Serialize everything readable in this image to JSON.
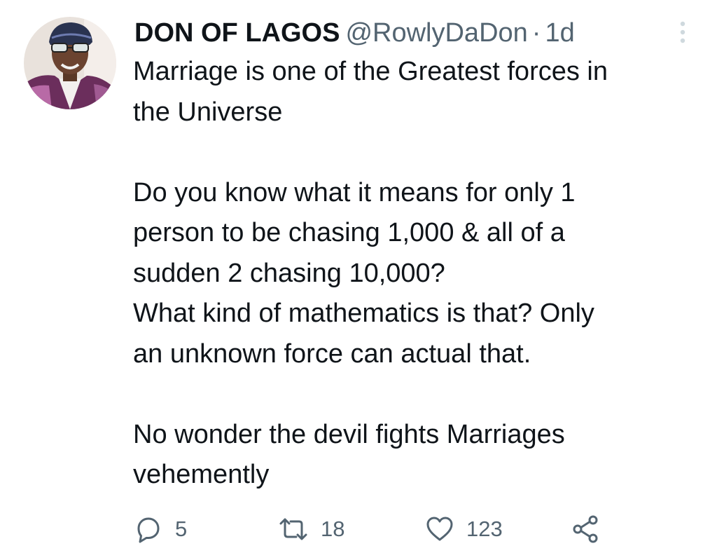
{
  "tweet": {
    "author": {
      "display_name": "DON OF LAGOS",
      "handle": "@RowlyDaDon",
      "separator": "·",
      "time": "1d"
    },
    "body": {
      "p1": [
        "Marriage is one of the Greatest forces in",
        "the Universe"
      ],
      "p2": [
        "Do you know what it means for only 1",
        "person to be chasing 1,000 & all of a",
        "sudden 2 chasing 10,000?",
        "What kind of mathematics is that? Only",
        "an unknown force can actual that."
      ],
      "p3": [
        "No wonder the devil fights Marriages",
        "vehemently"
      ]
    },
    "actions": {
      "replies": "5",
      "retweets": "18",
      "likes": "123"
    }
  },
  "icons": {
    "more": "more-vertical-icon",
    "reply": "reply-icon",
    "retweet": "retweet-icon",
    "like": "heart-icon",
    "share": "share-icon"
  },
  "colors": {
    "text_primary": "#0f1419",
    "text_secondary": "#536471",
    "icon": "#536471",
    "more_icon": "#cfd9de"
  }
}
